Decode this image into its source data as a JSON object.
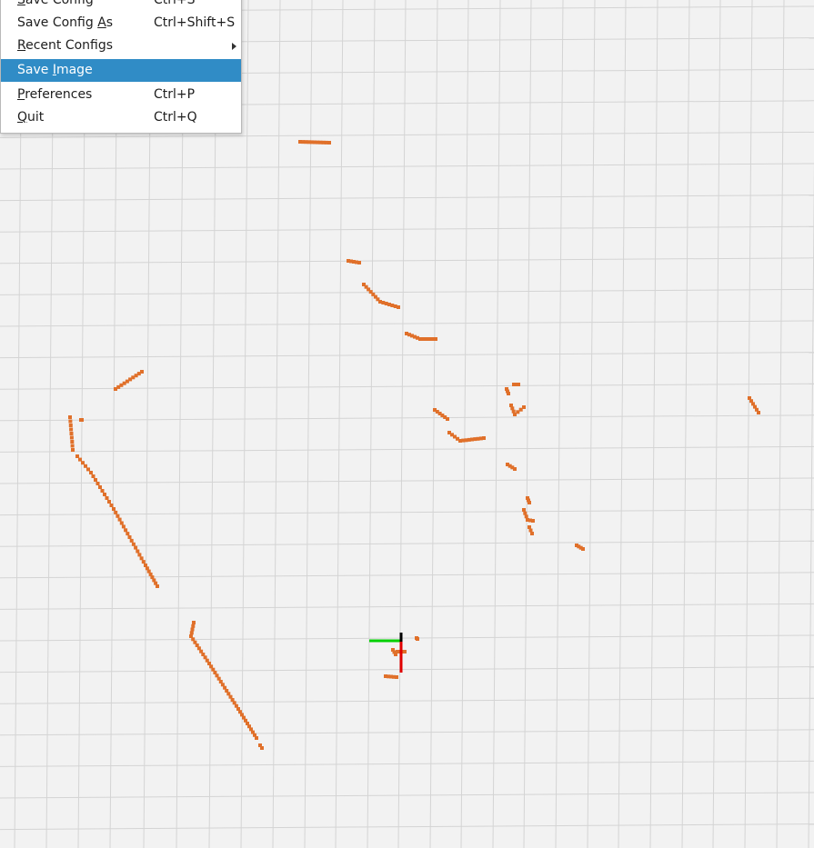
{
  "menu": {
    "items": [
      {
        "label": "Save Config",
        "mnemonic": "S",
        "shortcut": "Ctrl+S"
      },
      {
        "label": "Save Config As",
        "mnemonic": "A",
        "shortcut": "Ctrl+Shift+S"
      },
      {
        "label": "Recent Configs",
        "mnemonic": "R",
        "shortcut": ""
      },
      {
        "label": "Save Image",
        "mnemonic": "I",
        "shortcut": "",
        "highlighted": true
      },
      {
        "label": "Preferences",
        "mnemonic": "P",
        "shortcut": "Ctrl+P"
      },
      {
        "label": "Quit",
        "mnemonic": "Q",
        "shortcut": "Ctrl+Q"
      }
    ]
  },
  "colors": {
    "background": "#f2f2f2",
    "grid": "#d4d4d4",
    "scan_points": "#e0702a",
    "axis_x": "#e00000",
    "axis_y": "#00d000",
    "axis_z": "#000000",
    "menu_highlight": "#308cc6"
  },
  "icons": {
    "submenu_arrow": "chevron-right-icon"
  }
}
